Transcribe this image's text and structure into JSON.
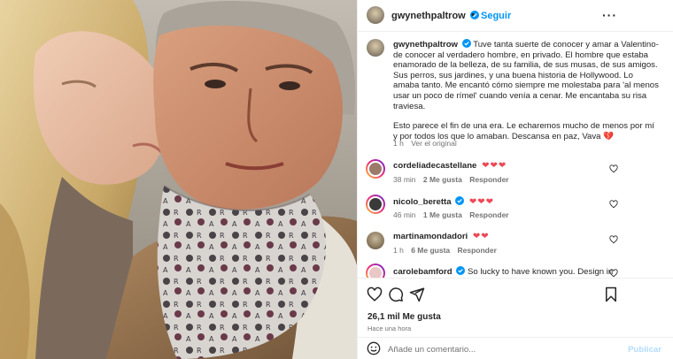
{
  "post": {
    "author": "gwynethpaltrow",
    "separator": "•",
    "follow_label": "Seguir",
    "more_label": "···"
  },
  "caption": {
    "author": "gwynethpaltrow",
    "paragraph1": "Tuve tanta suerte de conocer y amar a Valentino-de conocer al verdadero hombre, en privado. El hombre que estaba enamorado de la belleza, de su familia, de sus musas, de sus amigos. Sus perros, sus jardines, y una buena historia de Hollywood. Lo amaba tanto. Me encantó cómo siempre me molestaba para 'al menos usar un poco de rímel' cuando venía a cenar. Me encantaba su risa traviesa.",
    "paragraph2": "Esto parece el fin de una era. Le echaremos mucho de menos por mí y por todos los que lo amaban. Descansa en paz, Vava 💔",
    "age": "1 h",
    "translation": "Ver el original"
  },
  "comments": [
    {
      "user": "cordeliadecastellane",
      "text": "❤❤❤",
      "age": "38 min",
      "likes": "2 Me gusta",
      "reply": "Responder"
    },
    {
      "user": "nicolo_beretta",
      "text": "❤❤❤",
      "age": "46 min",
      "likes": "1 Me gusta",
      "reply": "Responder"
    },
    {
      "user": "martinamondadori",
      "text": "❤❤",
      "age": "1 h",
      "likes": "6 Me gusta",
      "reply": "Responder"
    },
    {
      "user": "carolebamford",
      "text": "So lucky to have known you. Design in"
    }
  ],
  "footer": {
    "likes": "26,1 mil Me gusta",
    "time": "Hace una hora",
    "add_comment_placeholder": "Añade un comentario...",
    "publish_label": "Publicar"
  },
  "icons": [
    "heart-icon",
    "comment-icon",
    "share-icon",
    "bookmark-icon",
    "emoji-icon",
    "verified-icon",
    "more-icon"
  ],
  "colors": {
    "link": "#0095f6",
    "heart": "#ed4956",
    "muted": "#737373",
    "verified": "#0095f6"
  }
}
